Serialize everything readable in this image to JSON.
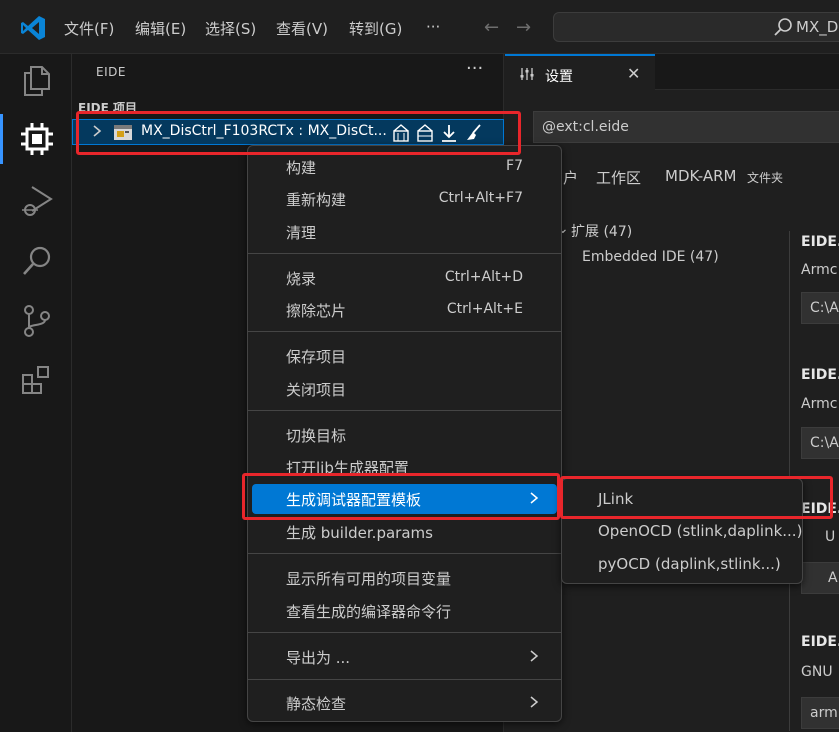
{
  "titlebar": {
    "menus": [
      "文件(F)",
      "编辑(E)",
      "选择(S)",
      "查看(V)",
      "转到(G)",
      "···"
    ],
    "nav_back": "←",
    "nav_forward": "→",
    "command_center_text": "MX_Dis"
  },
  "activity_bar": {
    "icons": [
      "files-icon",
      "eide-chip-icon",
      "run-debug-icon",
      "search-icon",
      "source-control-icon",
      "extensions-icon"
    ],
    "accent": "#3794ff"
  },
  "sidebar": {
    "title": "EIDE",
    "more": "···",
    "section_title": "EIDE 项目",
    "project_label": "MX_DisCtrl_F103RCTx : MX_DisCt..."
  },
  "editor": {
    "tab_label": "设置",
    "tab_close": "✕",
    "search_value": "@ext:cl.eide",
    "scope_tabs": {
      "user_partial": "户",
      "workspace": "工作区",
      "mdk": "MDK-ARM",
      "folder": "文件夹"
    },
    "toc": {
      "extensions": "扩展 (47)",
      "embedded_ide": "Embedded IDE (47)"
    },
    "settings": [
      {
        "title": "EIDE.",
        "desc": "Armc",
        "value": "C:\\A"
      },
      {
        "title": "EIDE.",
        "desc": "Armc",
        "value": "C:\\A"
      },
      {
        "title": "EIDE.",
        "desc": "U",
        "value": "A"
      },
      {
        "title": "EIDE.",
        "desc": "GNU",
        "value": "arm"
      }
    ]
  },
  "context_menu": {
    "groups": [
      [
        {
          "label": "构建",
          "key": "F7"
        },
        {
          "label": "重新构建",
          "key": "Ctrl+Alt+F7"
        },
        {
          "label": "清理",
          "key": ""
        }
      ],
      [
        {
          "label": "烧录",
          "key": "Ctrl+Alt+D"
        },
        {
          "label": "擦除芯片",
          "key": "Ctrl+Alt+E"
        }
      ],
      [
        {
          "label": "保存项目",
          "key": ""
        },
        {
          "label": "关闭项目",
          "key": ""
        }
      ],
      [
        {
          "label": "切换目标",
          "key": ""
        },
        {
          "label": "打开lib生成器配置",
          "key": ""
        },
        {
          "label": "生成调试器配置模板",
          "key": ""
        },
        {
          "label": "生成 builder.params",
          "key": ""
        }
      ],
      [
        {
          "label": "显示所有可用的项目变量",
          "key": ""
        },
        {
          "label": "查看生成的编译器命令行",
          "key": ""
        }
      ],
      [
        {
          "label": "导出为 ...",
          "key": ""
        }
      ],
      [
        {
          "label": "静态检查",
          "key": ""
        }
      ]
    ],
    "active_item": "生成调试器配置模板"
  },
  "submenu": {
    "items": [
      "JLink",
      "OpenOCD (stlink,daplink...)",
      "pyOCD (daplink,stlink...)"
    ]
  },
  "colors": {
    "highlight": "#e8262b",
    "selection": "#0078d4"
  }
}
